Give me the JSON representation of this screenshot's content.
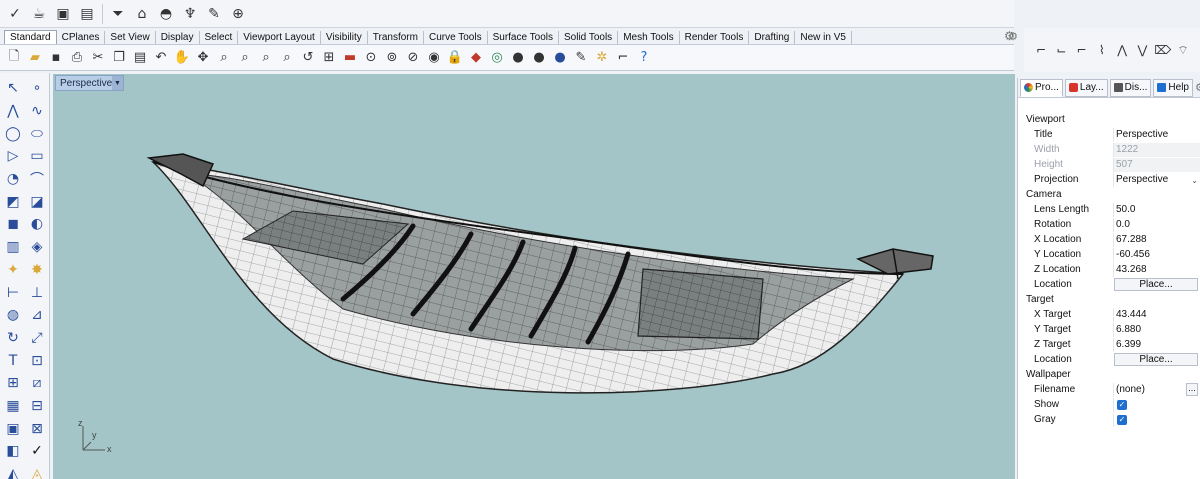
{
  "tabs": [
    "Standard",
    "CPlanes",
    "Set View",
    "Display",
    "Select",
    "Viewport Layout",
    "Visibility",
    "Transform",
    "Curve Tools",
    "Surface Tools",
    "Solid Tools",
    "Mesh Tools",
    "Render Tools",
    "Drafting",
    "New in V5"
  ],
  "active_tab": "Standard",
  "viewport": {
    "label": "Perspective",
    "axis_x": "x",
    "axis_y": "y",
    "axis_z": "z",
    "background": "#a4c5c7"
  },
  "panel": {
    "tabs": [
      {
        "label": "Pro...",
        "icon": "properties-icon",
        "color": "#d9342b"
      },
      {
        "label": "Lay...",
        "icon": "layers-icon",
        "color": "#d9342b"
      },
      {
        "label": "Dis...",
        "icon": "display-icon",
        "color": "#555555"
      },
      {
        "label": "Help",
        "icon": "help-icon",
        "color": "#1e6fcf"
      }
    ],
    "viewport_section": "Viewport",
    "title_label": "Title",
    "title_value": "Perspective",
    "width_label": "Width",
    "width_value": "1222",
    "height_label": "Height",
    "height_value": "507",
    "projection_label": "Projection",
    "projection_value": "Perspective",
    "camera_section": "Camera",
    "lens_label": "Lens Length",
    "lens_value": "50.0",
    "rotation_label": "Rotation",
    "rotation_value": "0.0",
    "xloc_label": "X Location",
    "xloc_value": "67.288",
    "yloc_label": "Y Location",
    "yloc_value": "-60.456",
    "zloc_label": "Z Location",
    "zloc_value": "43.268",
    "location_label": "Location",
    "place_button": "Place...",
    "target_section": "Target",
    "xtarget_label": "X Target",
    "xtarget_value": "43.444",
    "ytarget_label": "Y Target",
    "ytarget_value": "6.880",
    "ztarget_label": "Z Target",
    "ztarget_value": "6.399",
    "target_location_label": "Location",
    "target_place_button": "Place...",
    "wallpaper_section": "Wallpaper",
    "filename_label": "Filename",
    "filename_value": "(none)",
    "filename_button": "...",
    "show_label": "Show",
    "show_checked": true,
    "gray_label": "Gray",
    "gray_checked": true
  },
  "colors": {
    "accent": "#1e6fcf",
    "viewport_tab": "#b8cde6"
  }
}
